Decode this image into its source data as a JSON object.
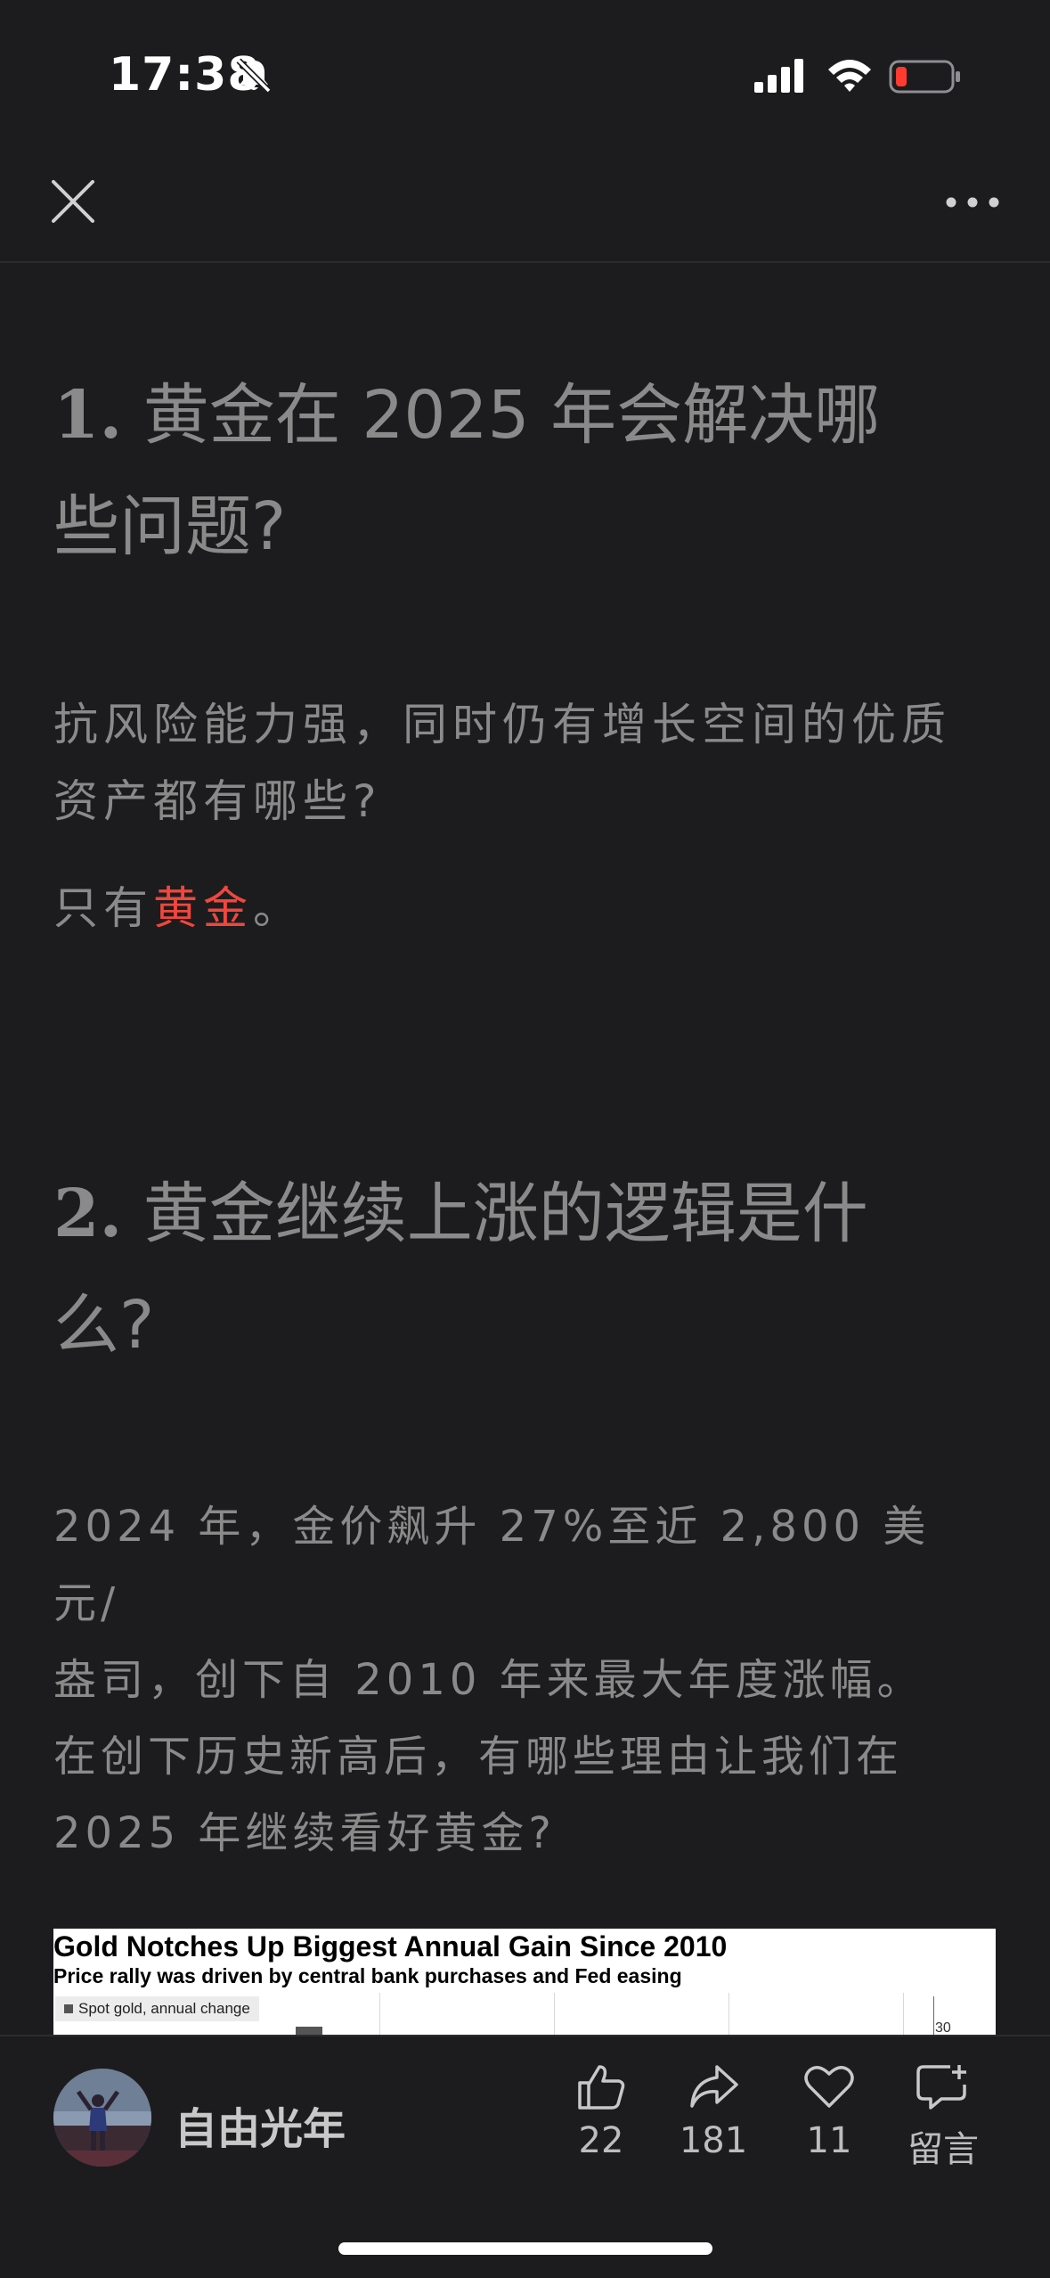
{
  "status_bar": {
    "time": "17:38",
    "battery_color": "#ff3b30"
  },
  "nav": {
    "close_icon": "close-icon",
    "more_icon": "more-icon"
  },
  "article": {
    "h1_num": "1.",
    "h1_line1": "黄金在 2025 年会解决哪",
    "h1_line2": "些问题?",
    "p1_line1": "抗风险能力强，同时仍有增长空间的优质",
    "p1_line2": "资产都有哪些?",
    "p2_before": "只有",
    "p2_highlight": "黄金",
    "p2_after": "。",
    "h2_num": "2.",
    "h2_line1": "黄金继续上涨的逻辑是什",
    "h2_line2": "么?",
    "p3_line1": "2024 年，金价飙升 27%至近 2,800 美元/",
    "p3_line2": "盎司，创下自 2010 年来最大年度涨幅。",
    "p3_line3": "在创下历史新高后，有哪些理由让我们在",
    "p3_line4": "2025 年继续看好黄金?",
    "highlight_color": "#f0473d"
  },
  "chart_image": {
    "title": "Gold Notches Up Biggest Annual Gain Since 2010",
    "subtitle": "Price rally was driven by central bank purchases and Fed easing",
    "legend": "Spot gold, annual change",
    "y_tick": "30"
  },
  "bottom_bar": {
    "author": "自由光年",
    "likes": "22",
    "shares": "181",
    "favorites": "11",
    "comment_label": "留言"
  }
}
